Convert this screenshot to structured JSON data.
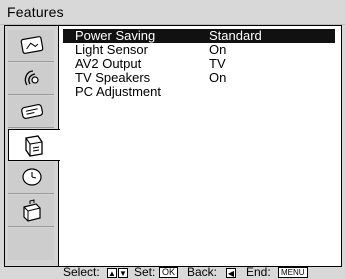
{
  "menu": {
    "title": "Features"
  },
  "tabs": [
    {
      "icon": "picture-icon",
      "active": false
    },
    {
      "icon": "sound-icon",
      "active": false
    },
    {
      "icon": "channel-icon",
      "active": false
    },
    {
      "icon": "features-icon",
      "active": true
    },
    {
      "icon": "timer-icon",
      "active": false
    },
    {
      "icon": "setup-icon",
      "active": false
    }
  ],
  "items": [
    {
      "label": "Power  Saving",
      "value": "Standard",
      "selected": true
    },
    {
      "label": "Light Sensor",
      "value": "On",
      "selected": false
    },
    {
      "label": "AV2  Output",
      "value": "TV",
      "selected": false
    },
    {
      "label": "TV Speakers",
      "value": "On",
      "selected": false
    },
    {
      "label": "PC Adjustment",
      "value": "",
      "selected": false
    }
  ],
  "footer": {
    "select_label": "Select:",
    "set_label": "Set:",
    "set_key": "OK",
    "back_label": "Back:",
    "end_label": "End:",
    "end_key": "MENU"
  }
}
